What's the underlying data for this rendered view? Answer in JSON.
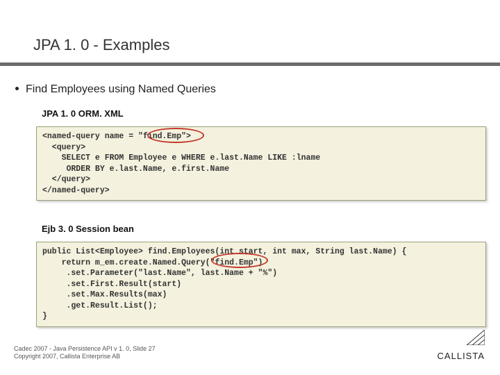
{
  "title": "JPA 1. 0 - Examples",
  "bullet": "Find Employees using Named Queries",
  "subhead1": "JPA 1. 0 ORM. XML",
  "code1": "<named-query name = \"find.Emp\">\n  <query>\n    SELECT e FROM Employee e WHERE e.last.Name LIKE :lname\n     ORDER BY e.last.Name, e.first.Name\n  </query>\n</named-query>",
  "subhead2": "Ejb 3. 0 Session bean",
  "code2": "public List<Employee> find.Employees(int start, int max, String last.Name) {\n    return m_em.create.Named.Query(\"find.Emp\")\n     .set.Parameter(\"last.Name\", last.Name + \"%\")\n     .set.First.Result(start)\n     .set.Max.Results(max)\n     .get.Result.List();\n}",
  "footer_line1": "Cadec 2007 - Java Persistence API v 1. 0, Slide 27",
  "footer_line2": "Copyright 2007, Callista Enterprise AB",
  "logo": "CALLISTA"
}
